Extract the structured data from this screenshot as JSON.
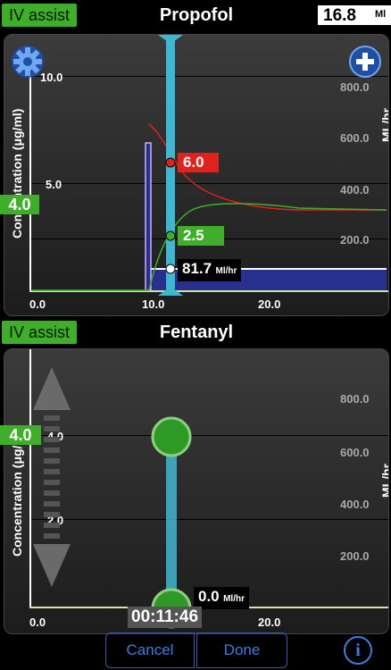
{
  "top": {
    "iv_assist": "IV assist",
    "title": "Propofol",
    "readout_value": "16.8",
    "readout_unit": "Ml"
  },
  "propofol_chart": {
    "y_left_label": "Concentration (μg/ml)",
    "y_right_label": "ML/hr",
    "y_left_ticks": [
      "10.0",
      "5.0"
    ],
    "y_right_ticks": [
      "800.0",
      "600.0",
      "400.0",
      "200.0"
    ],
    "x_ticks": [
      "0.0",
      "10.0",
      "20.0"
    ],
    "target_tag": "4.0",
    "plasma_value": "6.0",
    "effect_value": "2.5",
    "rate_value": "81.7",
    "rate_unit": "Ml/hr"
  },
  "fentanyl": {
    "iv_assist": "IV assist",
    "title": "Fentanyl"
  },
  "fentanyl_chart": {
    "y_left_label": "Concentration (μg/ml)",
    "y_right_label": "ML/hr",
    "y_left_ticks": [
      "4.0",
      "2.0"
    ],
    "y_right_ticks": [
      "800.0",
      "600.0",
      "400.0",
      "200.0"
    ],
    "x_ticks": [
      "0.0",
      "20.0"
    ],
    "target_tag": "4.0",
    "rate_value": "0.0",
    "rate_unit": "Ml/hr",
    "timer": "00:11:46"
  },
  "bottom": {
    "cancel": "Cancel",
    "done": "Done",
    "info": "i"
  },
  "colors": {
    "accent_green": "#3fae2a",
    "plasma_red": "#e0211c",
    "infusion_blue": "#27308c",
    "cursor_cyan": "#40b7d0"
  }
}
